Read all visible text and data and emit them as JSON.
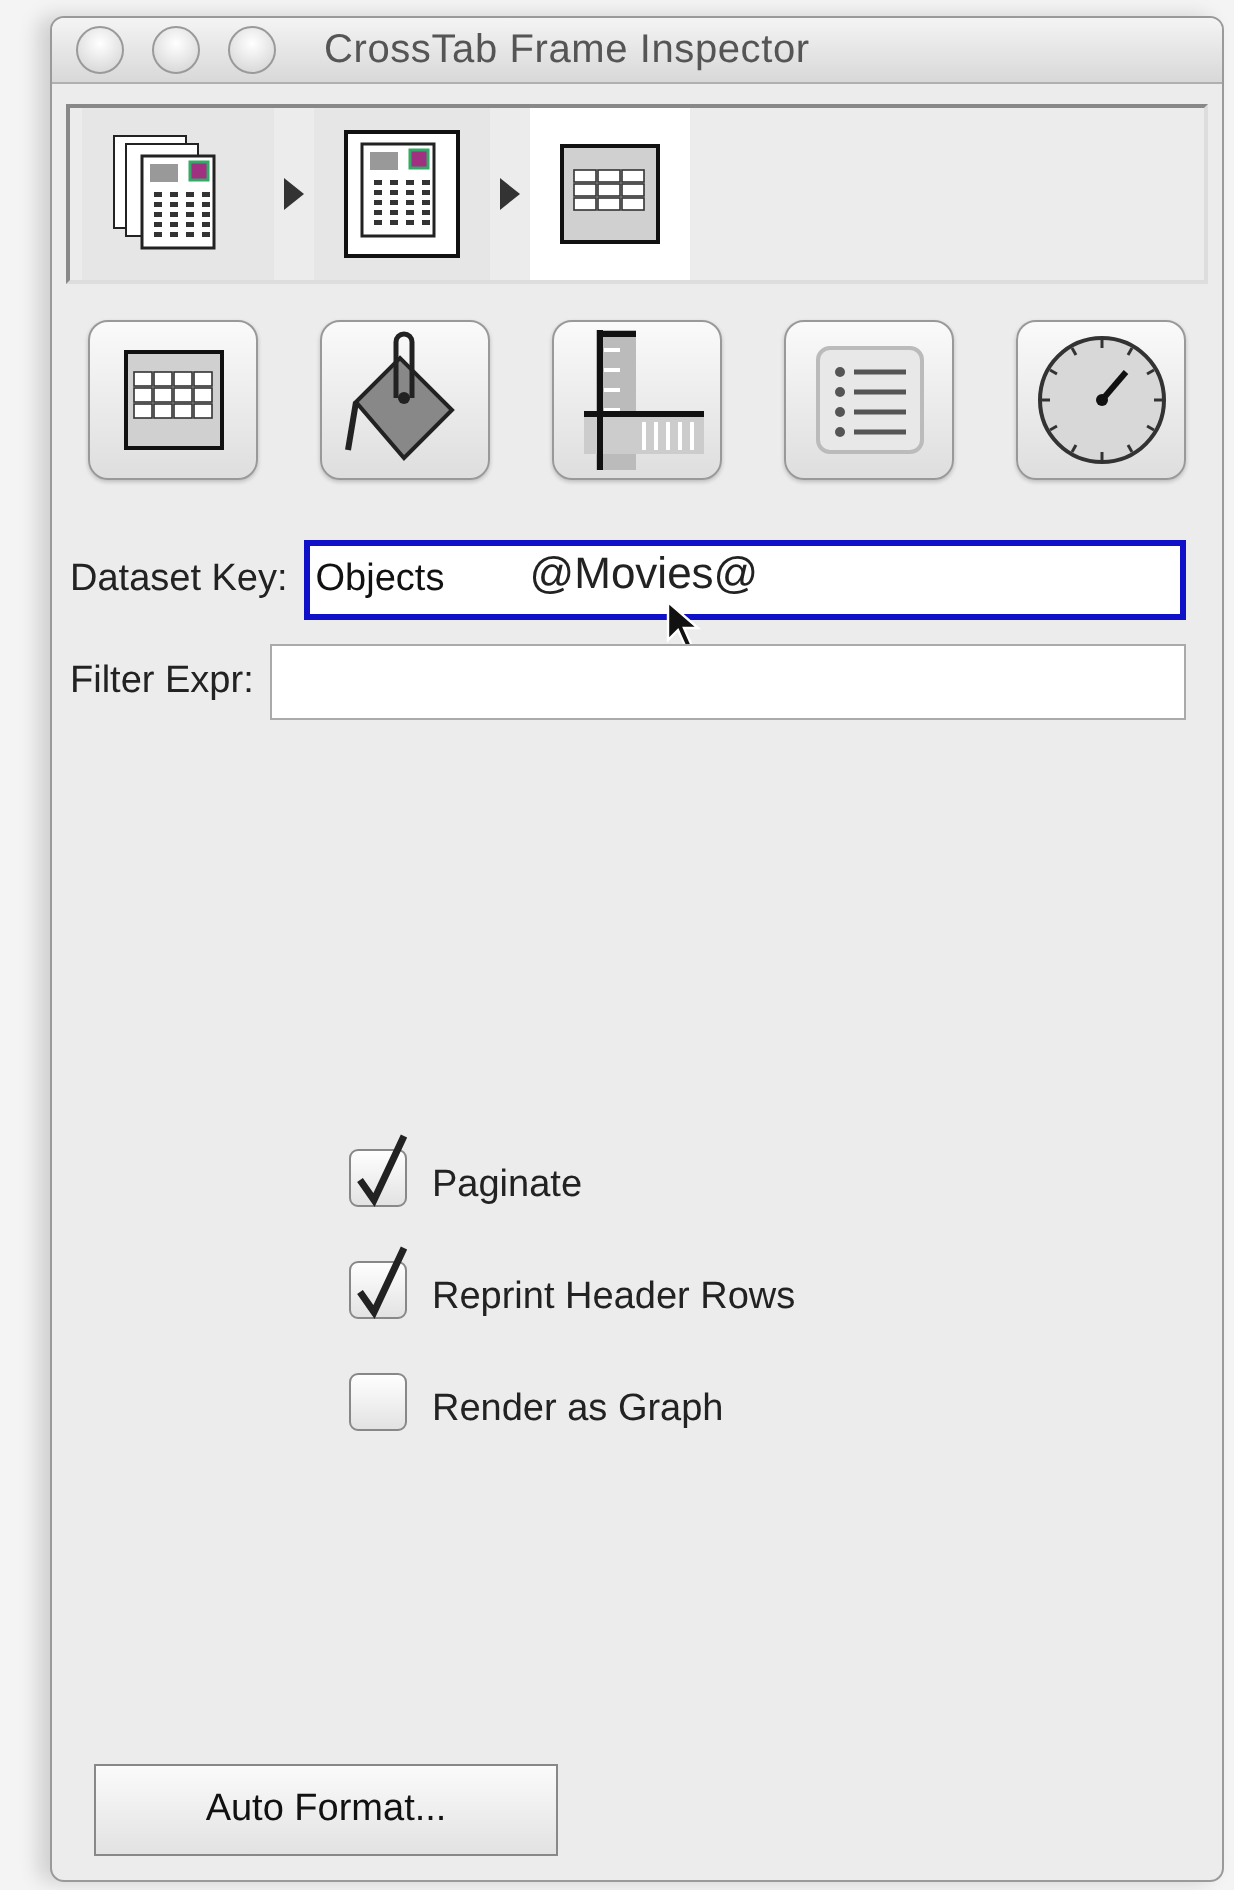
{
  "window": {
    "title": "CrossTab Frame Inspector"
  },
  "breadcrumb": [
    {
      "kind": "stack",
      "selected": false
    },
    {
      "kind": "page",
      "selected": false
    },
    {
      "kind": "table",
      "selected": true
    }
  ],
  "toolbar": [
    {
      "kind": "table"
    },
    {
      "kind": "paint"
    },
    {
      "kind": "ruler"
    },
    {
      "kind": "list"
    },
    {
      "kind": "gauge"
    }
  ],
  "fields": [
    {
      "label": "Dataset Key:",
      "value": "Objects",
      "focused": true
    },
    {
      "label": "Filter Expr:",
      "focused": false
    }
  ],
  "drag_text": "@Movies@",
  "checkboxes": [
    {
      "label": "Paginate",
      "checked": true
    },
    {
      "label": "Reprint Header Rows",
      "checked": true
    },
    {
      "label": "Render as Graph",
      "checked": false
    }
  ],
  "button": "Auto Format..."
}
